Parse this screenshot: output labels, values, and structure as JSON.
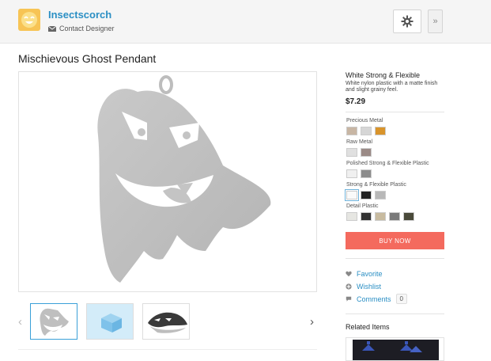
{
  "header": {
    "shop_name": "Insectscorch",
    "contact_label": "Contact Designer",
    "more_label": "»",
    "avatar_color": "#f7c455",
    "link_color": "#2b8fc4"
  },
  "product": {
    "title": "Mischievous Ghost Pendant"
  },
  "thumbnails": {
    "prev_arrow": "‹",
    "next_arrow": "›",
    "items": [
      {
        "name": "ghost-pendant-view",
        "selected": true
      },
      {
        "name": "packaging-box-view",
        "selected": false
      },
      {
        "name": "ghost-pendant-angled-view",
        "selected": false
      }
    ]
  },
  "material": {
    "name": "White Strong & Flexible",
    "description": "White nylon plastic with a matte finish and slight grainy feel.",
    "price": "$7.29",
    "groups": [
      {
        "label": "Precious Metal",
        "swatches": [
          "#c8b6a4",
          "#d6d6d6",
          "#d9942b"
        ]
      },
      {
        "label": "Raw Metal",
        "swatches": [
          "#e0e0e0",
          "#9a8a86"
        ]
      },
      {
        "label": "Polished Strong & Flexible Plastic",
        "swatches": [
          "#f0f0f0",
          "#8c8c8c"
        ]
      },
      {
        "label": "Strong & Flexible Plastic",
        "swatches": [
          "#fafafa",
          "#222222",
          "#b8b8b8"
        ],
        "selected_index": 0
      },
      {
        "label": "Detail Plastic",
        "swatches": [
          "#e6e6e2",
          "#333333",
          "#c8bba0",
          "#7a7a7a",
          "#4a4a3a"
        ]
      }
    ],
    "buy_label": "BUY NOW",
    "buy_color": "#f46a5e"
  },
  "actions": {
    "favorite_label": "Favorite",
    "wishlist_label": "Wishlist",
    "comments_label": "Comments",
    "comments_count": "0",
    "favorite_icon": "heart-icon",
    "wishlist_icon": "plus-circle-icon",
    "comments_icon": "speech-bubble-icon"
  },
  "related": {
    "title": "Related Items"
  }
}
